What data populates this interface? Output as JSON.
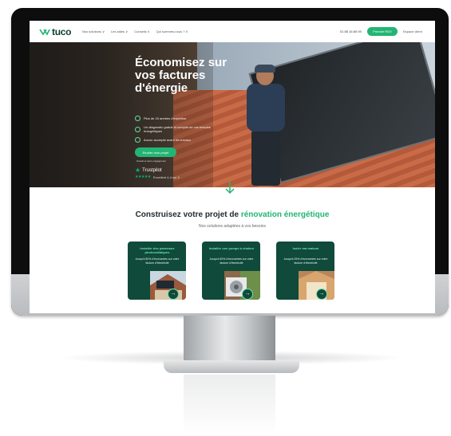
{
  "nav": {
    "logo": "tuco",
    "links": [
      "Nos solutions ∨",
      "Les aides ∨",
      "Conseils ∨",
      "Qui sommes-nous ? ∨"
    ],
    "phone": "01 85 16 80 09",
    "cta": "Prendre RDV",
    "account": "Espace client"
  },
  "hero": {
    "title": "Économisez sur vos factures d'énergie",
    "bullets": [
      "Plus de 15 années d'expertise",
      "Un diagnostic gratuit et complet de vos besoins énergétiques",
      "Aucun acompte avant les travaux"
    ],
    "cta": "Etudier mon projet",
    "cta_sub": "Gratuit et sans engagement",
    "trustpilot": "Trustpilot",
    "rating": "Excellent 4,4 sur 5"
  },
  "section": {
    "title_start": "Construisez votre projet de ",
    "title_highlight": "rénovation énergétique",
    "subtitle": "Nos solutions adaptées à vos besoins"
  },
  "cards": [
    {
      "title": "Installer des panneaux photovoltaïques",
      "text": "Jusqu'à 80% d'économies sur votre facture d'électricité"
    },
    {
      "title": "Installer une pompe à chaleur",
      "text": "Jusqu'à 60% d'économies sur votre facture d'électricité"
    },
    {
      "title": "Isoler ma maison",
      "text": "Jusqu'à 25% d'économies sur votre facture d'électricité"
    }
  ],
  "colors": {
    "accent": "#22b573",
    "card_bg": "#0f4a3a",
    "brand_dark": "#0e3b2e"
  }
}
